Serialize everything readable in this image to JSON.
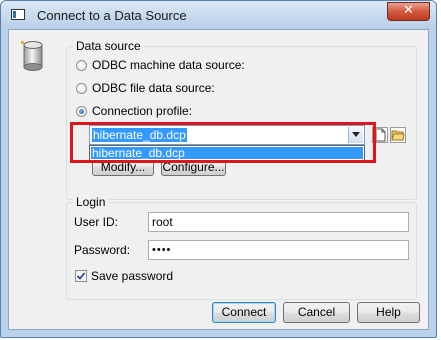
{
  "window": {
    "title": "Connect to a Data Source",
    "close_glyph": "✕"
  },
  "data_source": {
    "group_label": "Data source",
    "options": [
      {
        "label": "ODBC machine data source:",
        "checked": false
      },
      {
        "label": "ODBC file data source:",
        "checked": false
      },
      {
        "label": "Connection profile:",
        "checked": true
      }
    ],
    "profile_combo": {
      "value": "hibernate_db.dcp",
      "dropdown_items": [
        "hibernate_db.dcp"
      ]
    },
    "modify_button": "Modify...",
    "configure_button": "Configure..."
  },
  "login": {
    "group_label": "Login",
    "user_id_label": "User ID:",
    "user_id_value": "root",
    "password_label": "Password:",
    "password_value": "••••",
    "save_password_label": "Save password",
    "save_password_checked": true
  },
  "buttons": {
    "connect": "Connect",
    "cancel": "Cancel",
    "help": "Help"
  },
  "colors": {
    "highlight": "#e0141d",
    "selection": "#3399ff"
  },
  "icons": [
    "database-icon",
    "new-profile-icon",
    "open-folder-icon",
    "close-icon"
  ]
}
